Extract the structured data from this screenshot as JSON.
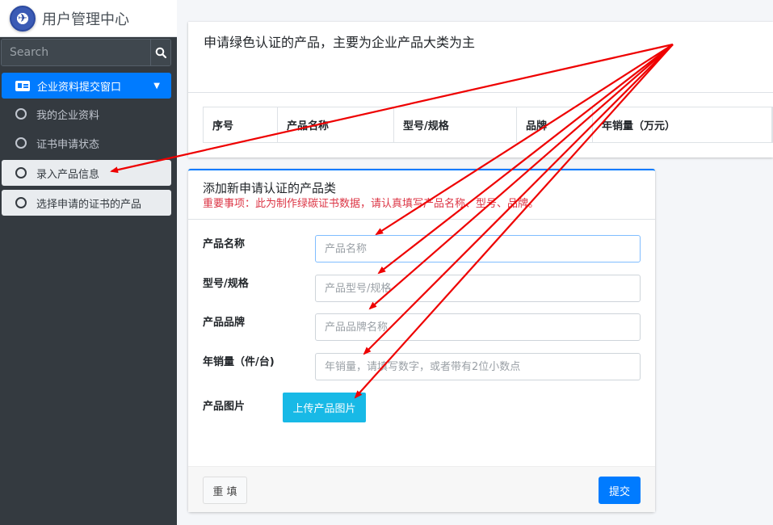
{
  "brand": {
    "title": "用户管理中心"
  },
  "search": {
    "placeholder": "Search"
  },
  "sidebar": {
    "active_item": "企业资料提交窗口",
    "items": [
      {
        "label": "我的企业资料"
      },
      {
        "label": "证书申请状态"
      },
      {
        "label": "录入产品信息"
      },
      {
        "label": "选择申请的证书的产品"
      }
    ]
  },
  "top_card": {
    "title": "申请绿色认证的产品，主要为企业产品大类为主",
    "columns": [
      "序号",
      "产品名称",
      "型号/规格",
      "品牌",
      "年销量（万元）"
    ]
  },
  "form": {
    "title": "添加新申请认证的产品类",
    "warning": "重要事项：此为制作绿碳证书数据，请认真填写产品名称、型号、品牌。",
    "fields": [
      {
        "label": "产品名称",
        "placeholder": "产品名称",
        "value": ""
      },
      {
        "label": "型号/规格",
        "placeholder": "产品型号/规格",
        "value": ""
      },
      {
        "label": "产品品牌",
        "placeholder": "产品品牌名称",
        "value": ""
      },
      {
        "label": "年销量（件/台)",
        "placeholder": "年销量，请填写数字，或者带有2位小数点",
        "value": ""
      }
    ],
    "image_label": "产品图片",
    "upload_label": "上传产品图片",
    "reset_label": "重 填",
    "submit_label": "提交"
  },
  "colors": {
    "primary": "#007bff",
    "sidebar_bg": "#343a40",
    "upload_btn": "#18b9e6",
    "warning_text": "#dc3545",
    "annotation_arrow": "#ee0000"
  },
  "icons": [
    "logo-icon",
    "search-icon",
    "id-card-icon",
    "chevron-down-icon",
    "circle-icon"
  ]
}
